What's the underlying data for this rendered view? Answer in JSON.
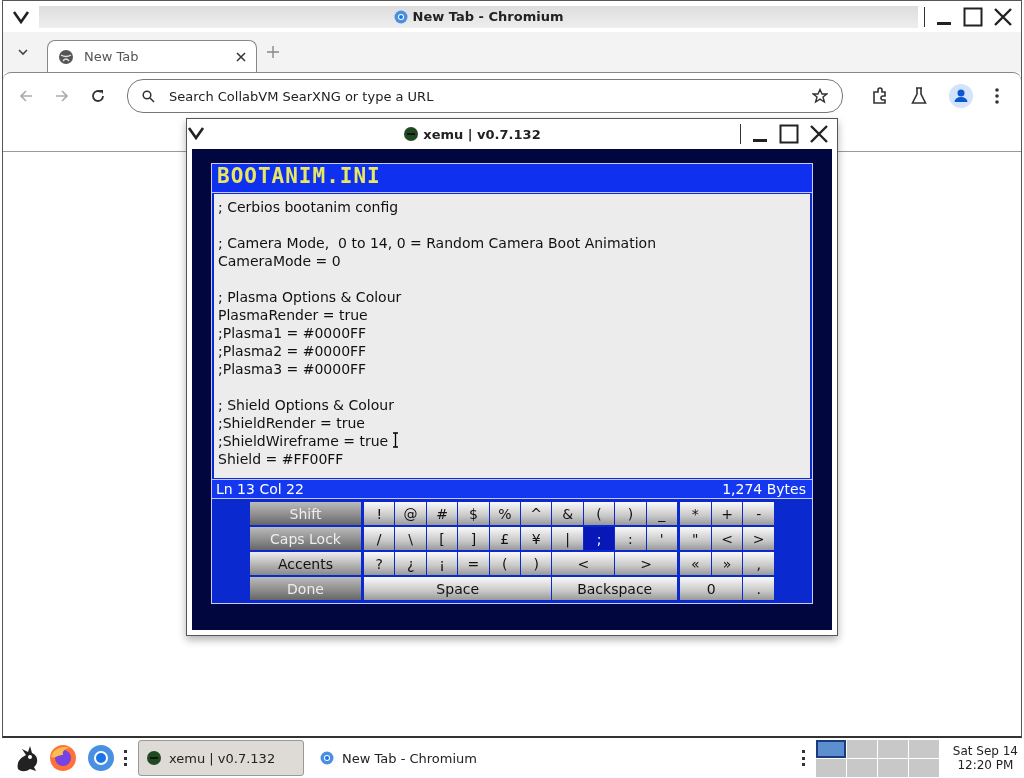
{
  "browser": {
    "title": "New Tab - Chromium",
    "tabs": [
      {
        "label": "New Tab",
        "selected": true
      }
    ],
    "address": {
      "placeholder": "Search CollabVM SearXNG or type a URL"
    }
  },
  "xemu": {
    "title": "xemu | v0.7.132",
    "file_title": "BOOTANIM.INI",
    "blocks": [
      {
        "lines": [
          "; Cerbios bootanim config"
        ]
      },
      {
        "lines": [
          "; Camera Mode,  0 to 14, 0 = Random Camera Boot Animation",
          "CameraMode = 0"
        ]
      },
      {
        "lines": [
          "; Plasma Options & Colour",
          "PlasmaRender = true",
          ";Plasma1 = #0000FF",
          ";Plasma2 = #0000FF",
          ";Plasma3 = #0000FF"
        ]
      },
      {
        "lines": [
          "; Shield Options & Colour",
          ";ShieldRender = true",
          ";ShieldWireframe = true",
          "Shield = #FF00FF"
        ]
      }
    ],
    "status": {
      "position": "Ln 13  Col 22",
      "size": "1,274 Bytes"
    },
    "keyboard": [
      {
        "side": {
          "label": "Shift",
          "disabled": true
        },
        "keys": [
          {
            "label": "!",
            "kind": "single",
            "selected": false
          },
          {
            "label": "@",
            "kind": "single",
            "selected": false
          },
          {
            "label": "#",
            "kind": "single",
            "selected": false
          },
          {
            "label": "$",
            "kind": "single",
            "selected": false
          },
          {
            "label": "%",
            "kind": "single",
            "selected": false
          },
          {
            "label": "^",
            "kind": "single",
            "selected": false
          },
          {
            "label": "&",
            "kind": "single",
            "selected": false
          },
          {
            "label": "(",
            "kind": "single",
            "selected": false
          },
          {
            "label": ")",
            "kind": "single",
            "selected": false
          },
          {
            "label": "_",
            "kind": "single",
            "selected": false
          }
        ],
        "extra": [
          {
            "label": "*",
            "kind": "single",
            "selected": false
          },
          {
            "label": "+",
            "kind": "single",
            "selected": false
          },
          {
            "label": "-",
            "kind": "single",
            "selected": false
          }
        ]
      },
      {
        "side": {
          "label": "Caps Lock",
          "disabled": true
        },
        "keys": [
          {
            "label": "/",
            "kind": "single",
            "selected": false
          },
          {
            "label": "\\",
            "kind": "single",
            "selected": false
          },
          {
            "label": "[",
            "kind": "single",
            "selected": false
          },
          {
            "label": "]",
            "kind": "single",
            "selected": false
          },
          {
            "label": "£",
            "kind": "single",
            "selected": false
          },
          {
            "label": "¥",
            "kind": "single",
            "selected": false
          },
          {
            "label": "|",
            "kind": "single",
            "selected": false
          },
          {
            "label": ";",
            "kind": "single",
            "selected": true
          },
          {
            "label": ":",
            "kind": "single",
            "selected": false
          },
          {
            "label": "'",
            "kind": "single",
            "selected": false
          }
        ],
        "extra": [
          {
            "label": "\"",
            "kind": "single",
            "selected": false
          },
          {
            "label": "<",
            "kind": "single",
            "selected": false
          },
          {
            "label": ">",
            "kind": "single",
            "selected": false
          }
        ]
      },
      {
        "side": {
          "label": "Accents",
          "disabled": false
        },
        "keys": [
          {
            "label": "?",
            "kind": "single",
            "selected": false
          },
          {
            "label": "¿",
            "kind": "single",
            "selected": false
          },
          {
            "label": "¡",
            "kind": "single",
            "selected": false
          },
          {
            "label": "=",
            "kind": "single",
            "selected": false
          },
          {
            "label": "(",
            "kind": "single",
            "selected": false
          },
          {
            "label": ")",
            "kind": "single",
            "selected": false
          },
          {
            "label": "<",
            "kind": "double",
            "selected": false
          },
          {
            "label": ">",
            "kind": "double",
            "selected": false
          }
        ],
        "extra": [
          {
            "label": "«",
            "kind": "single",
            "selected": false
          },
          {
            "label": "»",
            "kind": "single",
            "selected": false
          },
          {
            "label": ",",
            "kind": "single",
            "selected": false
          }
        ]
      },
      {
        "side": {
          "label": "Done",
          "disabled": true
        },
        "keys": [
          {
            "label": "Space",
            "kind": "sextuple",
            "selected": false
          },
          {
            "label": "Backspace",
            "kind": "quadruple",
            "selected": false
          }
        ],
        "extra": [
          {
            "label": "0",
            "kind": "double",
            "selected": false
          },
          {
            "label": ".",
            "kind": "single",
            "selected": false
          }
        ]
      }
    ]
  },
  "taskbar": {
    "tasks": [
      {
        "label": "xemu | v0.7.132",
        "kind": "xemu",
        "selected": true
      },
      {
        "label": "New Tab - Chromium",
        "kind": "chromium",
        "selected": false
      }
    ],
    "workspaces": [
      {
        "selected": true
      },
      {
        "selected": false
      },
      {
        "selected": false
      },
      {
        "selected": false
      },
      {
        "selected": false
      },
      {
        "selected": false
      },
      {
        "selected": false
      },
      {
        "selected": false
      }
    ],
    "clock": {
      "date": "Sat Sep 14",
      "time": "12:20 PM"
    }
  }
}
